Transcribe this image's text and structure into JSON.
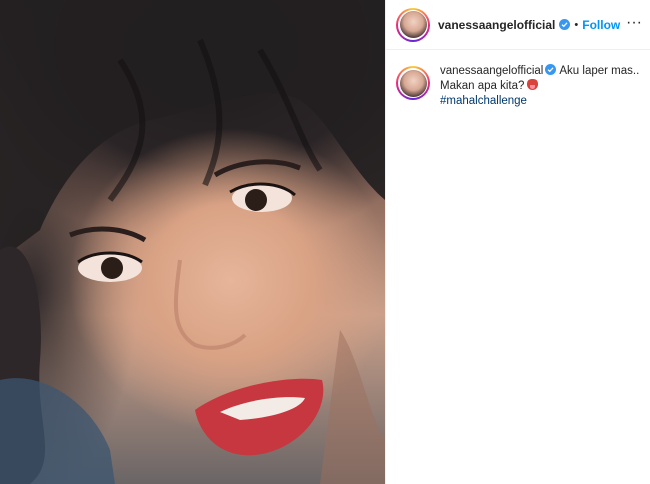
{
  "post": {
    "media_alt": "video frame",
    "header": {
      "username": "vanessaangelofficial",
      "separator": "•",
      "follow_label": "Follow",
      "more_label": "···"
    },
    "caption": {
      "username": "vanessaangelofficial",
      "text": "Aku laper mas.. Makan apa kita?",
      "hashtag": "#mahalchallenge"
    }
  },
  "colors": {
    "follow": "#0095f6",
    "verified": "#3897f0",
    "hashtag": "#00376b",
    "border": "#efefef"
  }
}
